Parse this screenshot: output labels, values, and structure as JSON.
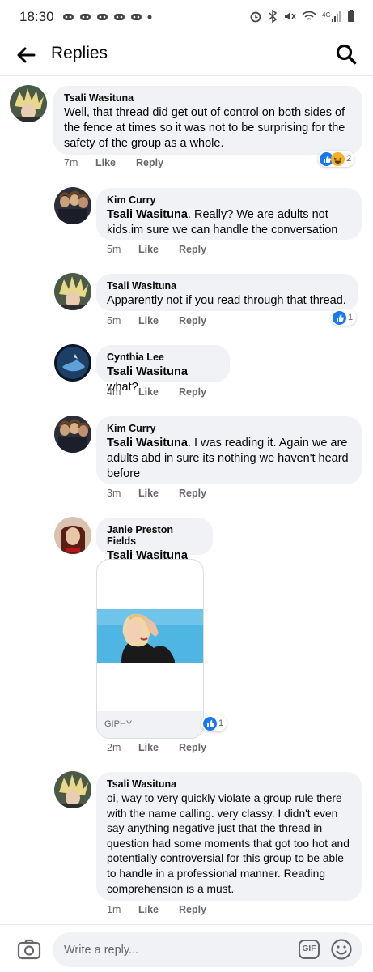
{
  "status_bar": {
    "time": "18:30"
  },
  "header": {
    "title": "Replies"
  },
  "comments": [
    {
      "author": "Tsali Wasituna",
      "text": "Well, that thread did get out of control on both sides of the fence at times so it was  not to be surprising for the safety of the group as a whole.",
      "time": "7m",
      "like": "Like",
      "reply": "Reply",
      "reaction_count": "2"
    },
    {
      "author": "Kim Curry",
      "mention": "Tsali Wasituna",
      "text": ". Really? We are adults not kids.im sure we can handle the conversation",
      "time": "5m",
      "like": "Like",
      "reply": "Reply"
    },
    {
      "author": "Tsali Wasituna",
      "text": "Apparently not if you read through that thread.",
      "time": "5m",
      "like": "Like",
      "reply": "Reply",
      "reaction_count": "1"
    },
    {
      "author": "Cynthia Lee",
      "mention": "Tsali Wasituna",
      "text": " what?",
      "time": "4m",
      "like": "Like",
      "reply": "Reply"
    },
    {
      "author": "Kim Curry",
      "mention": "Tsali Wasituna",
      "text": ". I was reading it. Again we are adults abd in sure its nothing we haven't heard before",
      "time": "3m",
      "like": "Like",
      "reply": "Reply"
    },
    {
      "author": "Janie Preston Fields",
      "mention": "Tsali Wasituna",
      "gif_label": "GIPHY",
      "time": "2m",
      "like": "Like",
      "reply": "Reply",
      "reaction_count": "1"
    },
    {
      "author": "Tsali Wasituna",
      "text": "oi, way to very quickly violate a group rule there with the name calling. very classy. I didn't even say anything negative just that the thread in question had some moments that got too hot and potentially controversial for this group to be able to handle in a professional manner. Reading comprehension is a must.",
      "time": "1m",
      "like": "Like",
      "reply": "Reply"
    }
  ],
  "composer": {
    "placeholder": "Write a reply...",
    "gif_label": "GIF"
  },
  "colors": {
    "like_blue": "#1877f2",
    "haha_yellow": "#f7b125",
    "bubble_gray": "#f0f2f5",
    "meta_gray": "#65676b"
  }
}
